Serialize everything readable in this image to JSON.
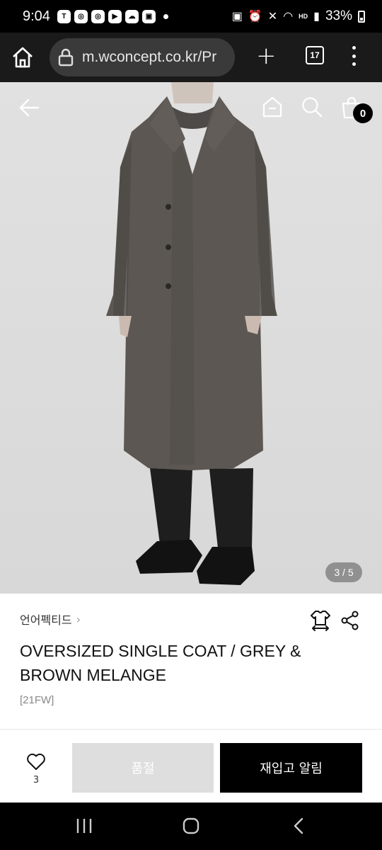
{
  "status_bar": {
    "time": "9:04",
    "notification_icons": [
      "talk-icon",
      "instagram-icon",
      "instagram-icon",
      "youtube-icon",
      "weather-icon",
      "gallery-icon"
    ],
    "hd_label": "HD",
    "battery": "33%"
  },
  "browser": {
    "url": "m.wconcept.co.kr/Pr",
    "tab_count": "17"
  },
  "product": {
    "image_counter": "3 / 5",
    "cart_count": "0",
    "brand": "언어펙티드",
    "title": "OVERSIZED SINGLE COAT / GREY & BROWN MELANGE",
    "season": "[21FW]"
  },
  "actions": {
    "wish_count": "3",
    "soldout_label": "품절",
    "restock_label": "재입고 알림"
  },
  "colors": {
    "accent": "#000000",
    "soldout_bg": "#dedede",
    "coat": "#5a5550"
  }
}
